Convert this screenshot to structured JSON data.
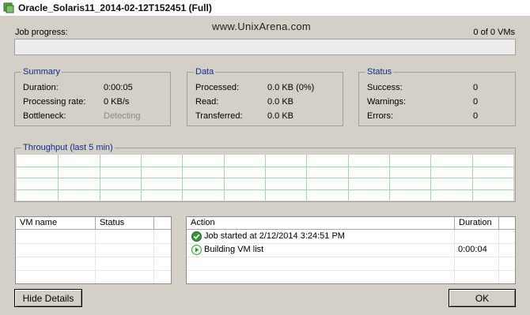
{
  "window": {
    "title": "Oracle_Solaris11_2014-02-12T152451 (Full)",
    "watermark": "www.UnixArena.com"
  },
  "job": {
    "progress_label": "Job progress:",
    "vm_count": "0 of 0 VMs",
    "progress_fraction": 0
  },
  "summary": {
    "title": "Summary",
    "rows": [
      {
        "label": "Duration:",
        "value": "0:00:05"
      },
      {
        "label": "Processing rate:",
        "value": "0 KB/s"
      },
      {
        "label": "Bottleneck:",
        "value": "Detecting"
      }
    ]
  },
  "data_group": {
    "title": "Data",
    "rows": [
      {
        "label": "Processed:",
        "value": "0.0 KB (0%)"
      },
      {
        "label": "Read:",
        "value": "0.0 KB"
      },
      {
        "label": "Transferred:",
        "value": "0.0 KB"
      }
    ]
  },
  "status_group": {
    "title": "Status",
    "rows": [
      {
        "label": "Success:",
        "value": "0"
      },
      {
        "label": "Warnings:",
        "value": "0"
      },
      {
        "label": "Errors:",
        "value": "0"
      }
    ]
  },
  "throughput": {
    "title": "Throughput (last 5 min)"
  },
  "vm_table": {
    "headers": [
      "VM name",
      "Status"
    ]
  },
  "action_table": {
    "headers": [
      "Action",
      "Duration"
    ],
    "rows": [
      {
        "icon": "check-circle-icon",
        "action": "Job started at 2/12/2014 3:24:51 PM",
        "duration": ""
      },
      {
        "icon": "play-circle-icon",
        "action": "Building VM list",
        "duration": "0:00:04"
      }
    ]
  },
  "buttons": {
    "hide_details": "Hide Details",
    "ok": "OK"
  },
  "colors": {
    "group_title": "#0b2f8a",
    "grid": "#9fdc9f",
    "success_icon": "#2f9a2f"
  }
}
